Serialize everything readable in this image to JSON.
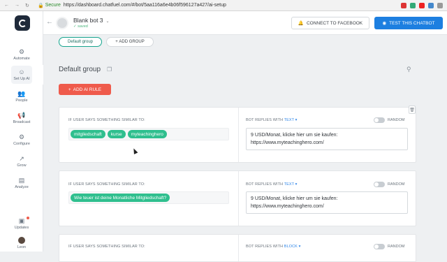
{
  "browser": {
    "secure_label": "Secure",
    "url": "https://dashboard.chatfuel.com/#/bot/5aa116a6e4b06f596127a427/ai-setup"
  },
  "sidebar": {
    "items": [
      {
        "label": "Automate",
        "icon": "automate-icon"
      },
      {
        "label": "Set Up AI",
        "icon": "ai-icon"
      },
      {
        "label": "People",
        "icon": "people-icon"
      },
      {
        "label": "Broadcast",
        "icon": "broadcast-icon"
      },
      {
        "label": "Configure",
        "icon": "configure-icon"
      },
      {
        "label": "Grow",
        "icon": "grow-icon"
      },
      {
        "label": "Analyze",
        "icon": "analyze-icon"
      },
      {
        "label": "Updates",
        "icon": "updates-icon"
      },
      {
        "label": "Leon",
        "icon": "avatar"
      }
    ]
  },
  "header": {
    "bot_name": "Blank bot 3",
    "bot_status": "✓ saved",
    "connect_label": "CONNECT TO FACEBOOK",
    "test_label": "TEST THIS CHATBOT"
  },
  "groups": {
    "active_label": "Default group",
    "add_label": "ADD GROUP"
  },
  "main": {
    "group_title": "Default group",
    "add_rule_label": "ADD AI RULE"
  },
  "rules": [
    {
      "user_label": "IF USER SAYS SOMETHING SIMILAR TO:",
      "bot_label": "BOT REPLIES WITH",
      "reply_kind": "TEXT ▾",
      "chips": [
        "mitgliedschaft",
        "kurse",
        "myteachinghero"
      ],
      "reply_line1": "9 USD/Monat, klicke hier um sie kaufen:",
      "reply_line2": "https://www.myteachinghero.com/",
      "random_label": "RANDOM"
    },
    {
      "user_label": "IF USER SAYS SOMETHING SIMILAR TO:",
      "bot_label": "BOT REPLIES WITH",
      "reply_kind": "TEXT ▾",
      "chips": [
        "Wie teuer ist deine Monatliche Mitgliedschaft?"
      ],
      "reply_line1": "9 USD/Monat, klicke hier um sie kaufen:",
      "reply_line2": "https://www.myteachinghero.com/",
      "random_label": "RANDOM"
    },
    {
      "user_label": "IF USER SAYS SOMETHING SIMILAR TO:",
      "bot_label": "BOT REPLIES WITH",
      "reply_kind": "BLOCK ▾",
      "random_label": "RANDOM"
    }
  ],
  "colors": {
    "accent_green": "#2fbf8e",
    "brand_blue": "#1d7fe0",
    "add_rule_red": "#ef5b4c"
  }
}
